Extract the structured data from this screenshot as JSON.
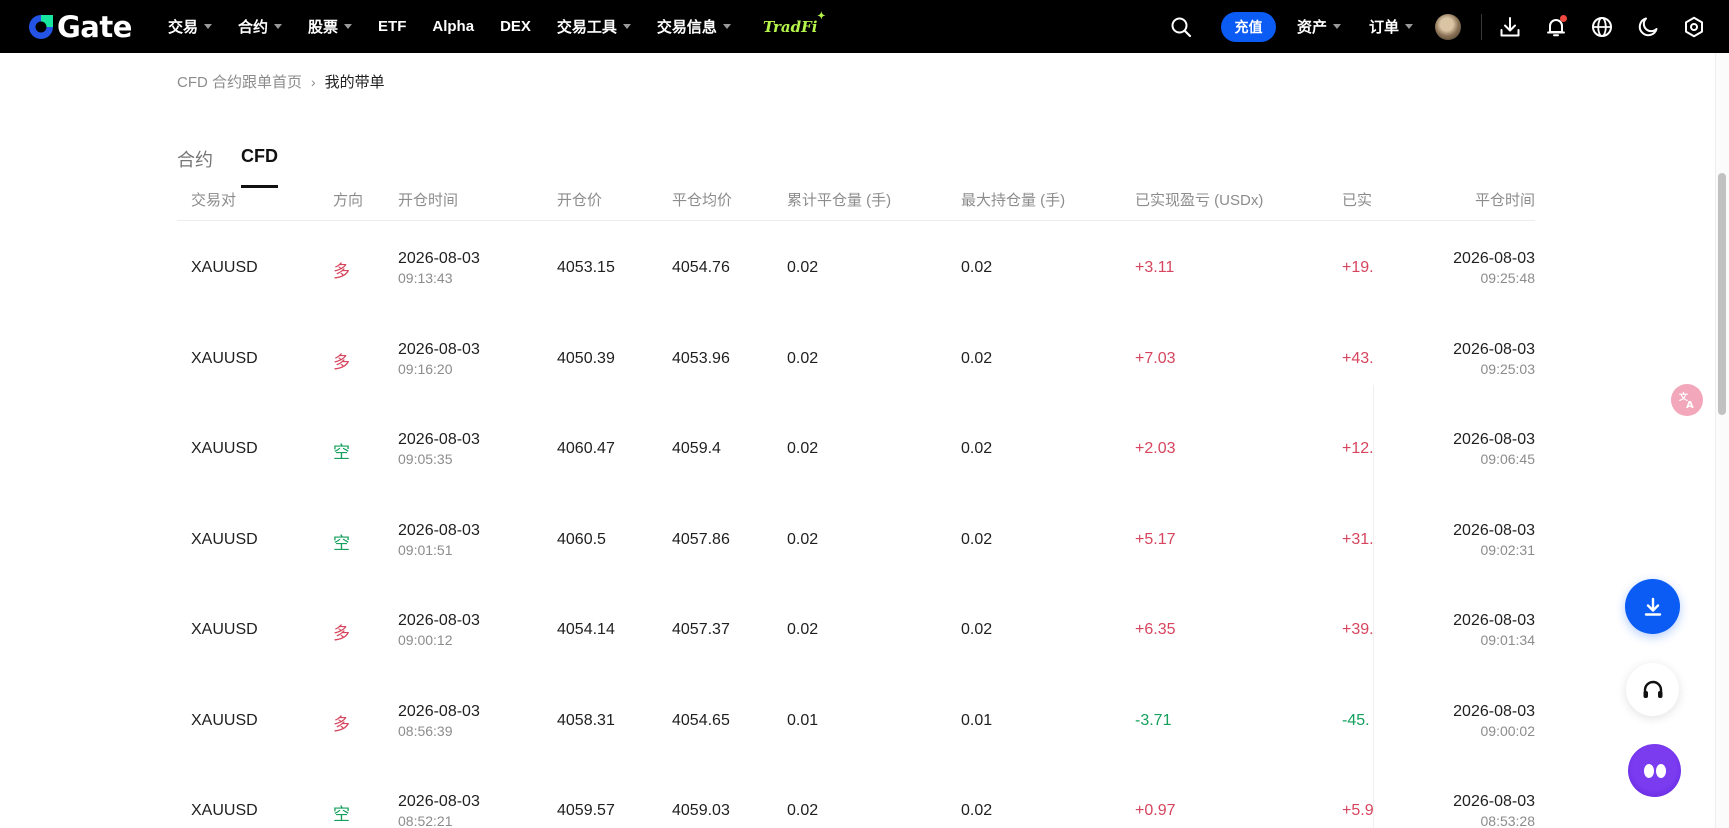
{
  "brand": {
    "name": "Gate"
  },
  "nav": {
    "items": [
      {
        "label": "交易",
        "caret": true
      },
      {
        "label": "合约",
        "caret": true
      },
      {
        "label": "股票",
        "caret": true
      },
      {
        "label": "ETF",
        "caret": false
      },
      {
        "label": "Alpha",
        "caret": false
      },
      {
        "label": "DEX",
        "caret": false
      },
      {
        "label": "交易工具",
        "caret": true
      },
      {
        "label": "交易信息",
        "caret": true
      }
    ],
    "tradfi_label": "TradFi",
    "deposit_label": "充值",
    "assets_label": "资产",
    "orders_label": "订单"
  },
  "breadcrumb": {
    "parent": "CFD 合约跟单首页",
    "current": "我的带单"
  },
  "tabs": [
    {
      "label": "合约"
    },
    {
      "label": "CFD"
    }
  ],
  "table": {
    "headers": {
      "pair": "交易对",
      "side": "方向",
      "open_time": "开仓时间",
      "open_price": "开仓价",
      "close_avg": "平仓均价",
      "closed_qty": "累计平仓量 (手)",
      "max_qty": "最大持仓量 (手)",
      "pnl": "已实现盈亏 (USDx)",
      "pnl_pct_truncated": "已实",
      "close_time": "平仓时间"
    },
    "rows": [
      {
        "pair": "XAUUSD",
        "side": "多",
        "side_type": "long",
        "open_date": "2026-08-03",
        "open_clock": "09:13:43",
        "open_price": "4053.15",
        "close_avg": "4054.76",
        "closed_qty": "0.02",
        "max_qty": "0.02",
        "pnl": "+3.11",
        "pnl_sign": "pos",
        "pnl_pct": "+19.",
        "close_date": "2026-08-03",
        "close_clock": "09:25:48"
      },
      {
        "pair": "XAUUSD",
        "side": "多",
        "side_type": "long",
        "open_date": "2026-08-03",
        "open_clock": "09:16:20",
        "open_price": "4050.39",
        "close_avg": "4053.96",
        "closed_qty": "0.02",
        "max_qty": "0.02",
        "pnl": "+7.03",
        "pnl_sign": "pos",
        "pnl_pct": "+43.",
        "close_date": "2026-08-03",
        "close_clock": "09:25:03"
      },
      {
        "pair": "XAUUSD",
        "side": "空",
        "side_type": "short",
        "open_date": "2026-08-03",
        "open_clock": "09:05:35",
        "open_price": "4060.47",
        "close_avg": "4059.4",
        "closed_qty": "0.02",
        "max_qty": "0.02",
        "pnl": "+2.03",
        "pnl_sign": "pos",
        "pnl_pct": "+12.",
        "close_date": "2026-08-03",
        "close_clock": "09:06:45"
      },
      {
        "pair": "XAUUSD",
        "side": "空",
        "side_type": "short",
        "open_date": "2026-08-03",
        "open_clock": "09:01:51",
        "open_price": "4060.5",
        "close_avg": "4057.86",
        "closed_qty": "0.02",
        "max_qty": "0.02",
        "pnl": "+5.17",
        "pnl_sign": "pos",
        "pnl_pct": "+31.",
        "close_date": "2026-08-03",
        "close_clock": "09:02:31"
      },
      {
        "pair": "XAUUSD",
        "side": "多",
        "side_type": "long",
        "open_date": "2026-08-03",
        "open_clock": "09:00:12",
        "open_price": "4054.14",
        "close_avg": "4057.37",
        "closed_qty": "0.02",
        "max_qty": "0.02",
        "pnl": "+6.35",
        "pnl_sign": "pos",
        "pnl_pct": "+39.",
        "close_date": "2026-08-03",
        "close_clock": "09:01:34"
      },
      {
        "pair": "XAUUSD",
        "side": "多",
        "side_type": "long",
        "open_date": "2026-08-03",
        "open_clock": "08:56:39",
        "open_price": "4058.31",
        "close_avg": "4054.65",
        "closed_qty": "0.01",
        "max_qty": "0.01",
        "pnl": "-3.71",
        "pnl_sign": "neg",
        "pnl_pct": "-45.",
        "close_date": "2026-08-03",
        "close_clock": "09:00:02"
      },
      {
        "pair": "XAUUSD",
        "side": "空",
        "side_type": "short",
        "open_date": "2026-08-03",
        "open_clock": "08:52:21",
        "open_price": "4059.57",
        "close_avg": "4059.03",
        "closed_qty": "0.02",
        "max_qty": "0.02",
        "pnl": "+0.97",
        "pnl_sign": "pos",
        "pnl_pct": "+5.9",
        "close_date": "2026-08-03",
        "close_clock": "08:53:28"
      }
    ]
  },
  "colors": {
    "long": "#d6455d",
    "short": "#14a05c",
    "accent": "#0a5cf5",
    "tradfi": "#b6f54a"
  },
  "icons": {
    "search": "search-icon",
    "download": "download-icon",
    "bell": "bell-icon",
    "globe": "globe-icon",
    "theme": "moon-icon",
    "settings": "hexagon-settings-icon",
    "translate": "translate-icon",
    "support": "headset-icon",
    "bot": "ai-assistant-icon"
  }
}
